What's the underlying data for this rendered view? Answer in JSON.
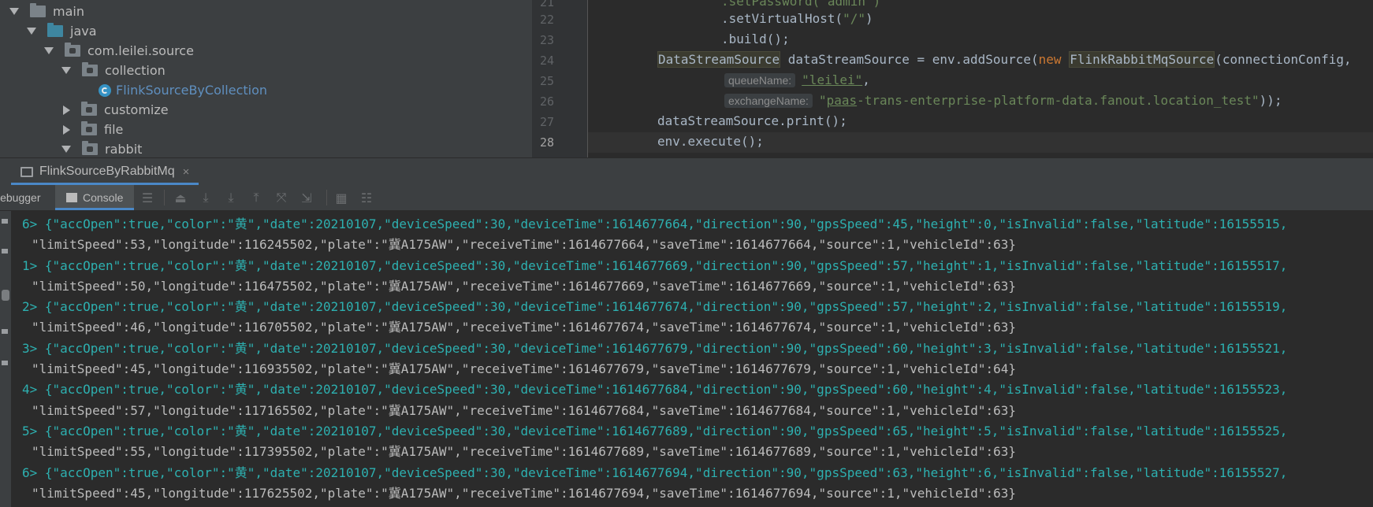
{
  "project_tree": {
    "items": [
      {
        "label": "main",
        "expanded": true,
        "icon": "folder-icon"
      },
      {
        "label": "java",
        "expanded": true,
        "icon": "source-folder-icon"
      },
      {
        "label": "com.leilei.source",
        "expanded": true,
        "icon": "package-icon"
      },
      {
        "label": "collection",
        "expanded": true,
        "icon": "package-icon"
      },
      {
        "label": "FlinkSourceByCollection",
        "icon": "class-icon"
      },
      {
        "label": "customize",
        "expanded": false,
        "icon": "package-icon"
      },
      {
        "label": "file",
        "expanded": false,
        "icon": "package-icon"
      },
      {
        "label": "rabbit",
        "expanded": true,
        "icon": "package-icon"
      }
    ]
  },
  "editor": {
    "line_numbers": [
      "21",
      "22",
      "23",
      "24",
      "25",
      "26",
      "27",
      "28"
    ],
    "current_line": "28",
    "lines": {
      "l21": ".setPassword(\"admin\")",
      "l22a": ".setVirtualHost(",
      "l22b": "\"/\"",
      "l22c": ")",
      "l23": ".build();",
      "l24a": "DataStreamSource",
      "l24b": " dataStreamSource = env.addSource(",
      "l24c": "new",
      "l24d": "FlinkRabbitMqSource",
      "l24e": "(connectionConfig,",
      "l25_hint": "queueName:",
      "l25_val": "\"leilei\"",
      "l25_tail": ",",
      "l26_hint": "exchangeName:",
      "l26_q": "\"",
      "l26_paas": "paas",
      "l26_rest": "-trans-enterprise-platform-data.fanout.location_test\"",
      "l26_tail": "));",
      "l27": "dataStreamSource.print();",
      "l28": "env.execute();"
    }
  },
  "run_tab": {
    "label": "FlinkSourceByRabbitMq",
    "close": "×"
  },
  "toolbar": {
    "debugger": "Debugger",
    "console": "Console"
  },
  "colors": {
    "string": "#6a8759",
    "keyword": "#cc7832",
    "console_text": "#2db0b0",
    "accent": "#4a88c7"
  },
  "console": {
    "records": [
      {
        "first": "6> {\"accOpen\":true,\"color\":\"黄\",\"date\":20210107,\"deviceSpeed\":30,\"deviceTime\":1614677664,\"direction\":90,\"gpsSpeed\":45,\"height\":0,\"isInvalid\":false,\"latitude\":16155515,",
        "second": "\"limitSpeed\":53,\"longitude\":116245502,\"plate\":\"冀A175AW\",\"receiveTime\":1614677664,\"saveTime\":1614677664,\"source\":1,\"vehicleId\":63}"
      },
      {
        "first": "1> {\"accOpen\":true,\"color\":\"黄\",\"date\":20210107,\"deviceSpeed\":30,\"deviceTime\":1614677669,\"direction\":90,\"gpsSpeed\":57,\"height\":1,\"isInvalid\":false,\"latitude\":16155517,",
        "second": "\"limitSpeed\":50,\"longitude\":116475502,\"plate\":\"冀A175AW\",\"receiveTime\":1614677669,\"saveTime\":1614677669,\"source\":1,\"vehicleId\":63}"
      },
      {
        "first": "2> {\"accOpen\":true,\"color\":\"黄\",\"date\":20210107,\"deviceSpeed\":30,\"deviceTime\":1614677674,\"direction\":90,\"gpsSpeed\":57,\"height\":2,\"isInvalid\":false,\"latitude\":16155519,",
        "second": "\"limitSpeed\":46,\"longitude\":116705502,\"plate\":\"冀A175AW\",\"receiveTime\":1614677674,\"saveTime\":1614677674,\"source\":1,\"vehicleId\":63}"
      },
      {
        "first": "3> {\"accOpen\":true,\"color\":\"黄\",\"date\":20210107,\"deviceSpeed\":30,\"deviceTime\":1614677679,\"direction\":90,\"gpsSpeed\":60,\"height\":3,\"isInvalid\":false,\"latitude\":16155521,",
        "second": "\"limitSpeed\":45,\"longitude\":116935502,\"plate\":\"冀A175AW\",\"receiveTime\":1614677679,\"saveTime\":1614677679,\"source\":1,\"vehicleId\":64}"
      },
      {
        "first": "4> {\"accOpen\":true,\"color\":\"黄\",\"date\":20210107,\"deviceSpeed\":30,\"deviceTime\":1614677684,\"direction\":90,\"gpsSpeed\":60,\"height\":4,\"isInvalid\":false,\"latitude\":16155523,",
        "second": "\"limitSpeed\":57,\"longitude\":117165502,\"plate\":\"冀A175AW\",\"receiveTime\":1614677684,\"saveTime\":1614677684,\"source\":1,\"vehicleId\":63}"
      },
      {
        "first": "5> {\"accOpen\":true,\"color\":\"黄\",\"date\":20210107,\"deviceSpeed\":30,\"deviceTime\":1614677689,\"direction\":90,\"gpsSpeed\":65,\"height\":5,\"isInvalid\":false,\"latitude\":16155525,",
        "second": "\"limitSpeed\":55,\"longitude\":117395502,\"plate\":\"冀A175AW\",\"receiveTime\":1614677689,\"saveTime\":1614677689,\"source\":1,\"vehicleId\":63}"
      },
      {
        "first": "6> {\"accOpen\":true,\"color\":\"黄\",\"date\":20210107,\"deviceSpeed\":30,\"deviceTime\":1614677694,\"direction\":90,\"gpsSpeed\":63,\"height\":6,\"isInvalid\":false,\"latitude\":16155527,",
        "second": "\"limitSpeed\":45,\"longitude\":117625502,\"plate\":\"冀A175AW\",\"receiveTime\":1614677694,\"saveTime\":1614677694,\"source\":1,\"vehicleId\":63}"
      }
    ]
  }
}
